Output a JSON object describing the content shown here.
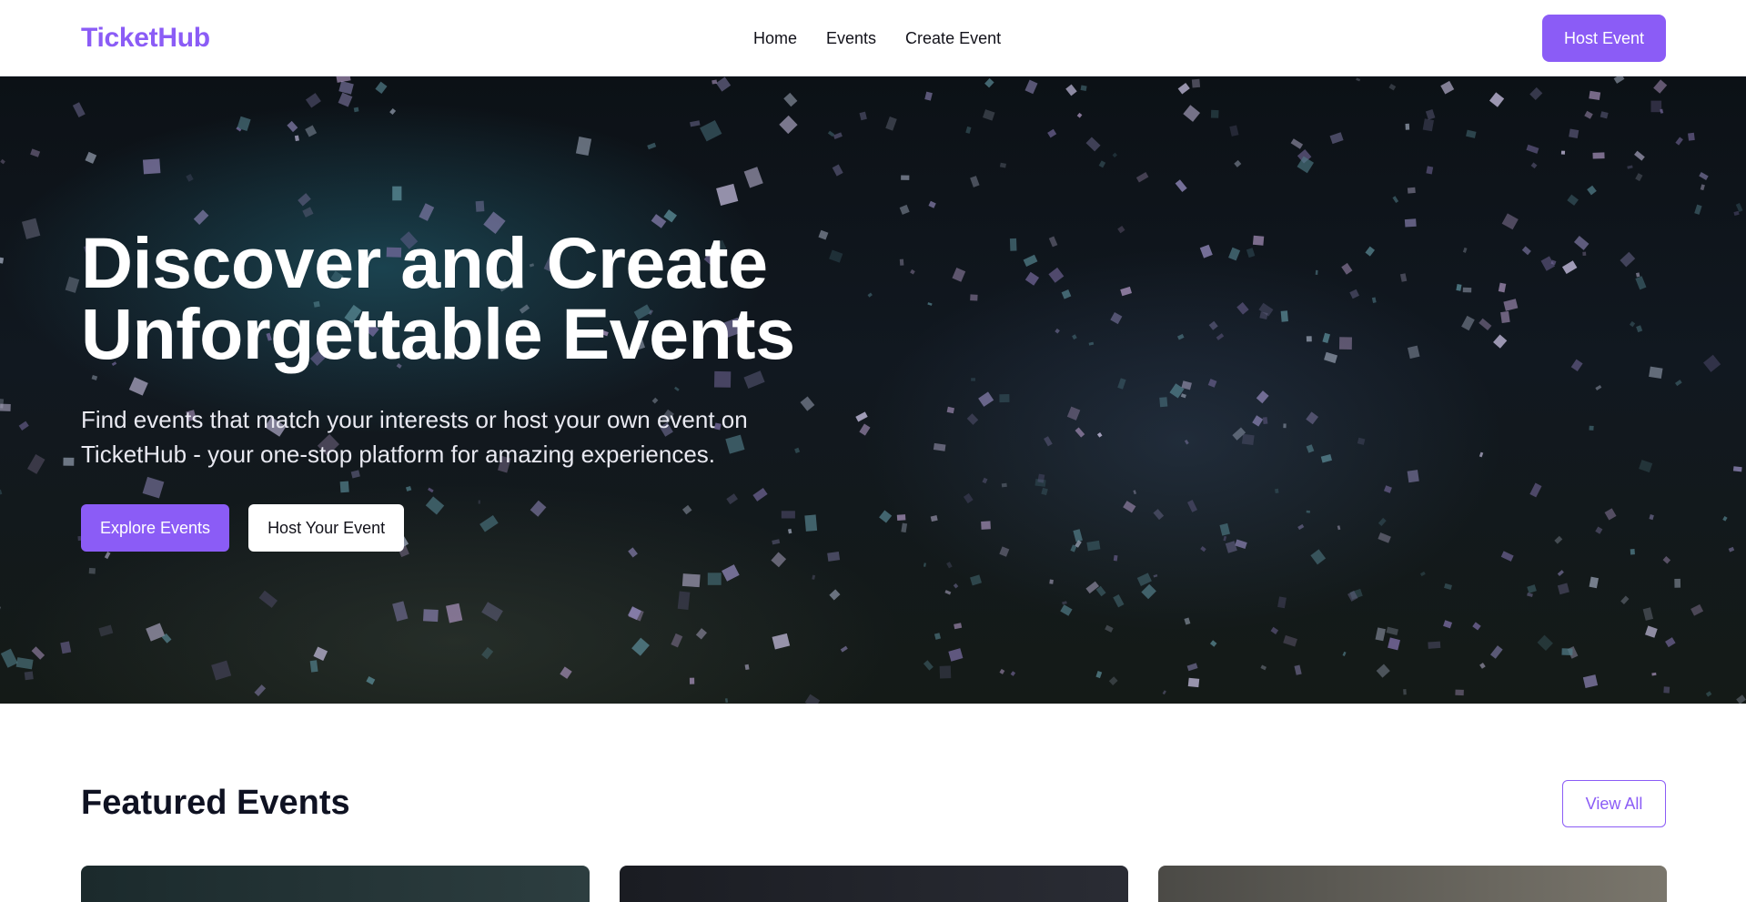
{
  "header": {
    "logo": "TicketHub",
    "nav": [
      {
        "label": "Home"
      },
      {
        "label": "Events"
      },
      {
        "label": "Create Event"
      }
    ],
    "host_button": "Host Event"
  },
  "hero": {
    "title_line1": "Discover and Create",
    "title_line2": "Unforgettable Events",
    "subtitle": "Find events that match your interests or host your own event on TicketHub - your one-stop platform for amazing experiences.",
    "primary_button": "Explore Events",
    "secondary_button": "Host Your Event",
    "background": "confetti-celebration-image"
  },
  "featured": {
    "title": "Featured Events",
    "view_all": "View All",
    "cards": [
      {
        "image": "event-image-1"
      },
      {
        "image": "event-image-2"
      },
      {
        "image": "event-image-3"
      }
    ]
  },
  "colors": {
    "accent": "#8b5cf6",
    "text": "#0f1222",
    "hero_bg": "#0c1116"
  }
}
